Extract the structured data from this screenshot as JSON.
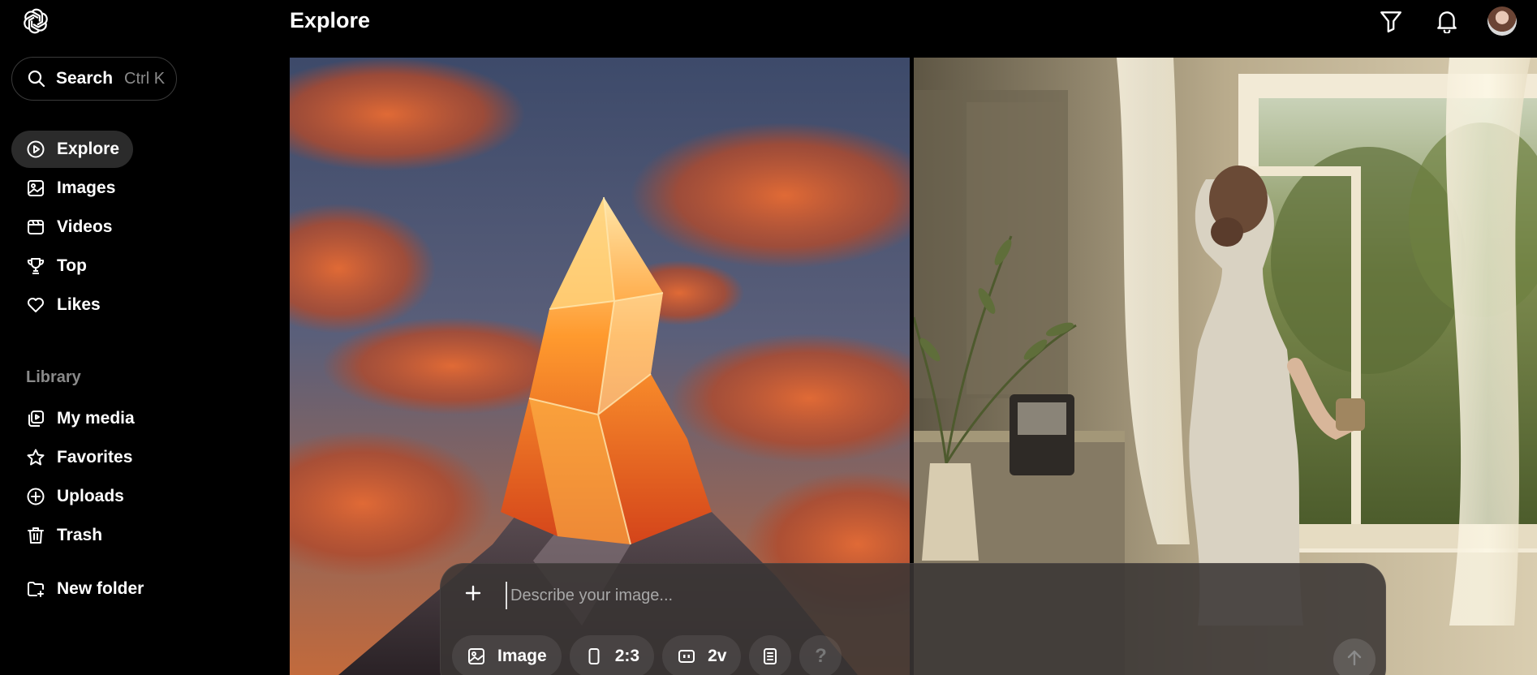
{
  "app": {
    "logo_icon": "openai-logo-icon"
  },
  "search": {
    "label": "Search",
    "shortcut": "Ctrl K",
    "icon": "search-icon"
  },
  "nav": {
    "items": [
      {
        "label": "Explore",
        "icon": "compass-icon",
        "active": true
      },
      {
        "label": "Images",
        "icon": "image-icon"
      },
      {
        "label": "Videos",
        "icon": "video-icon"
      },
      {
        "label": "Top",
        "icon": "trophy-icon"
      },
      {
        "label": "Likes",
        "icon": "heart-icon"
      }
    ]
  },
  "library": {
    "label": "Library",
    "items": [
      {
        "label": "My media",
        "icon": "media-icon"
      },
      {
        "label": "Favorites",
        "icon": "star-icon"
      },
      {
        "label": "Uploads",
        "icon": "upload-plus-icon"
      },
      {
        "label": "Trash",
        "icon": "trash-icon"
      }
    ],
    "new_folder": {
      "label": "New folder",
      "icon": "folder-plus-icon"
    }
  },
  "header": {
    "title": "Explore",
    "icons": [
      "filter-icon",
      "bell-icon",
      "avatar"
    ]
  },
  "composer": {
    "placeholder": "Describe your image...",
    "chips": {
      "type": "Image",
      "ratio": "2:3",
      "variations": "2v"
    }
  },
  "colors": {
    "background": "#000000",
    "active_nav": "#2b2b2b",
    "muted_text": "#8a8a8a"
  }
}
